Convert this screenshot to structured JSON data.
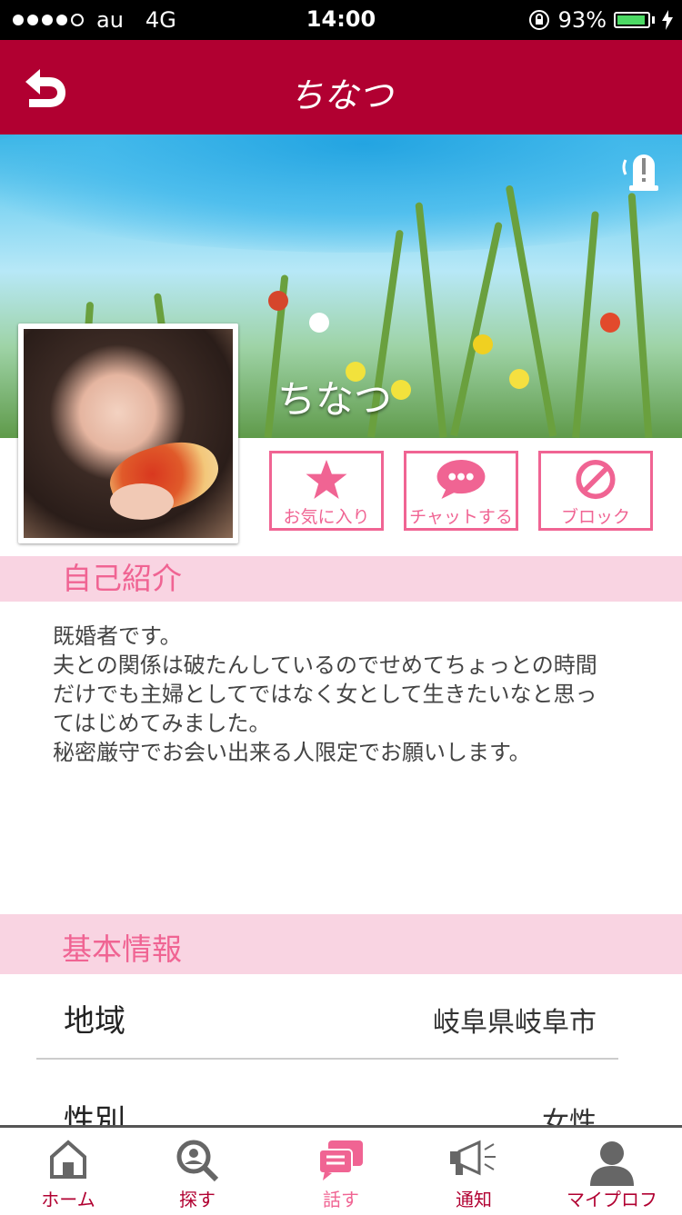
{
  "status_bar": {
    "carrier": "au",
    "network": "4G",
    "time": "14:00",
    "battery": "93%",
    "battery_level": 0.93
  },
  "header": {
    "title": "ちなつ",
    "back_icon": "back-arrow-icon"
  },
  "profile": {
    "name": "ちなつ"
  },
  "actions": [
    {
      "label": "お気に入り",
      "icon": "star-icon"
    },
    {
      "label": "チャットする",
      "icon": "chat-bubble-icon"
    },
    {
      "label": "ブロック",
      "icon": "block-icon"
    }
  ],
  "intro": {
    "heading": "自己紹介",
    "lines": [
      "既婚者です。",
      "夫との関係は破たんしているのでせめてちょっとの時間",
      "だけでも主婦としてではなく女として生きたいなと思っ",
      "てはじめてみました。",
      "秘密厳守でお会い出来る人限定でお願いします。"
    ]
  },
  "basic_info": {
    "heading": "基本情報",
    "rows": [
      {
        "key": "地域",
        "value": "岐阜県岐阜市"
      },
      {
        "key": "性別",
        "value": "女性"
      }
    ]
  },
  "tabbar": [
    {
      "label": "ホーム",
      "icon": "home-icon"
    },
    {
      "label": "探す",
      "icon": "search-icon"
    },
    {
      "label": "話す",
      "icon": "talk-icon",
      "active": true
    },
    {
      "label": "通知",
      "icon": "megaphone-icon"
    },
    {
      "label": "マイプロフ",
      "icon": "person-icon"
    }
  ],
  "colors": {
    "header": "#b10031",
    "accent": "#f06493",
    "section_bg": "#f9d4e2"
  }
}
